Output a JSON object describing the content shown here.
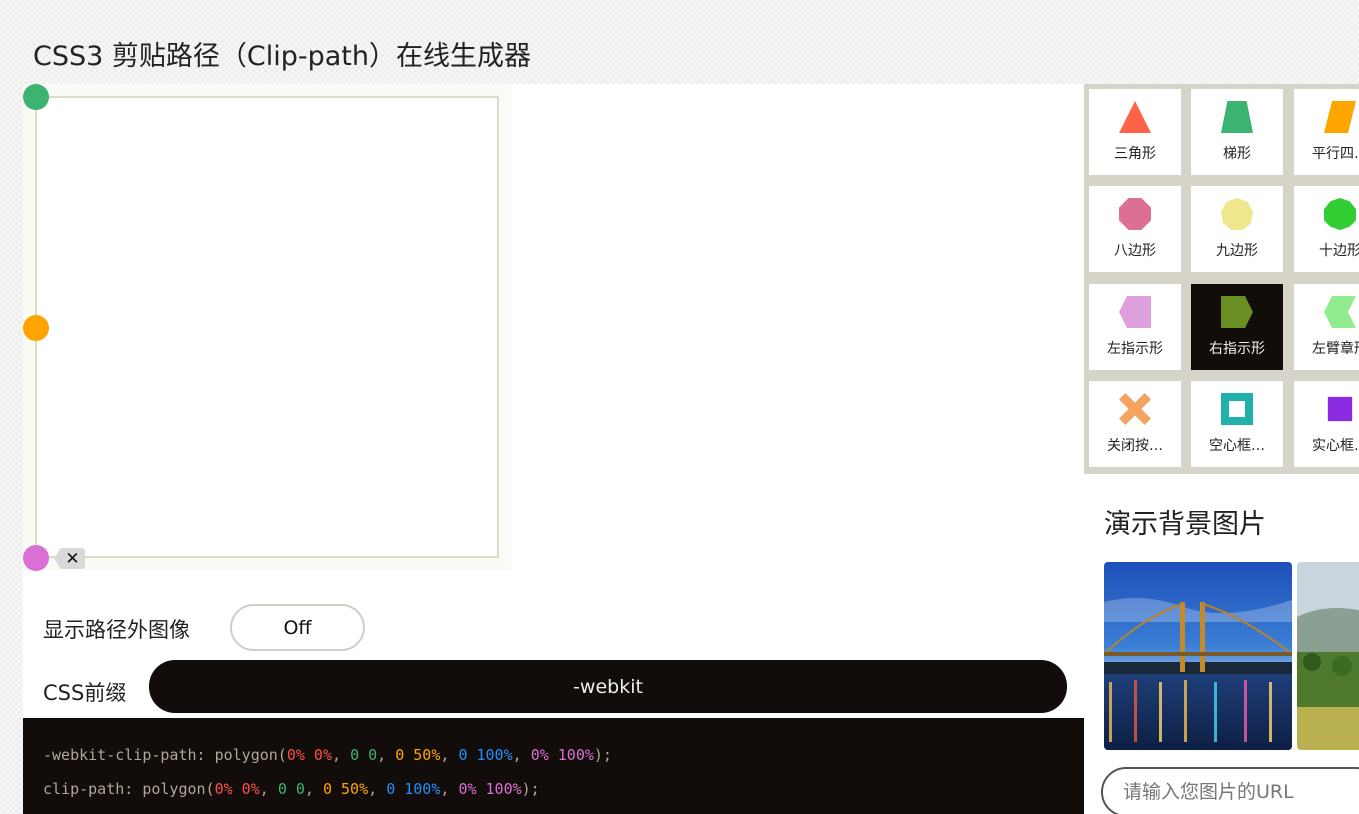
{
  "page": {
    "title": "CSS3 剪贴路径（Clip-path）在线生成器"
  },
  "editor": {
    "delete_point_icon": "close-icon",
    "points": [
      {
        "name": "point-1",
        "color": "#3cb371"
      },
      {
        "name": "point-2",
        "color": "#ffa500"
      },
      {
        "name": "point-3",
        "color": "#da70d6"
      }
    ]
  },
  "options": {
    "show_outside_label": "显示路径外图像",
    "show_outside_value": "Off",
    "prefix_label": "CSS前缀",
    "prefix_value": "-webkit"
  },
  "code": {
    "line1_prop": "-webkit-clip-path: polygon(",
    "line2_prop": "clip-path: polygon(",
    "values": [
      {
        "text": "0% 0%",
        "color": "#ff4d4d"
      },
      {
        "text": "0 0",
        "color": "#3cb371"
      },
      {
        "text": "0 50%",
        "color": "#ffa500"
      },
      {
        "text": "0 100%",
        "color": "#1e90ff"
      },
      {
        "text": "0% 100%",
        "color": "#da70d6"
      }
    ],
    "separator": ", ",
    "suffix": ");"
  },
  "shapes": [
    {
      "label": "三角形",
      "icon": "triangle-icon",
      "color": "#ff6347",
      "active": false
    },
    {
      "label": "梯形",
      "icon": "trapezoid-icon",
      "color": "#3cb371",
      "active": false
    },
    {
      "label": "平行四…",
      "icon": "parallelogram-icon",
      "color": "#ffa500",
      "active": false
    },
    {
      "label": "八边形",
      "icon": "octagon-icon",
      "color": "#db7093",
      "active": false
    },
    {
      "label": "九边形",
      "icon": "nonagon-icon",
      "color": "#f0e68c",
      "active": false
    },
    {
      "label": "十边形",
      "icon": "decagon-icon",
      "color": "#32cd32",
      "active": false
    },
    {
      "label": "左指示形",
      "icon": "left-point-icon",
      "color": "#dda0dd",
      "active": false
    },
    {
      "label": "右指示形",
      "icon": "right-point-icon",
      "color": "#6b8e23",
      "active": true
    },
    {
      "label": "左臂章形",
      "icon": "left-chevron-icon",
      "color": "#90ee90",
      "active": false
    },
    {
      "label": "关闭按…",
      "icon": "close-shape-icon",
      "color": "#f4a460",
      "active": false
    },
    {
      "label": "空心框…",
      "icon": "frame-icon",
      "color": "#20b2aa",
      "active": false
    },
    {
      "label": "实心框…",
      "icon": "square-icon",
      "color": "#8a2be2",
      "active": false
    }
  ],
  "backgrounds": {
    "heading": "演示背景图片",
    "images": [
      {
        "name": "bridge-night-thumbnail"
      },
      {
        "name": "countryside-thumbnail"
      }
    ],
    "url_placeholder": "请输入您图片的URL"
  }
}
